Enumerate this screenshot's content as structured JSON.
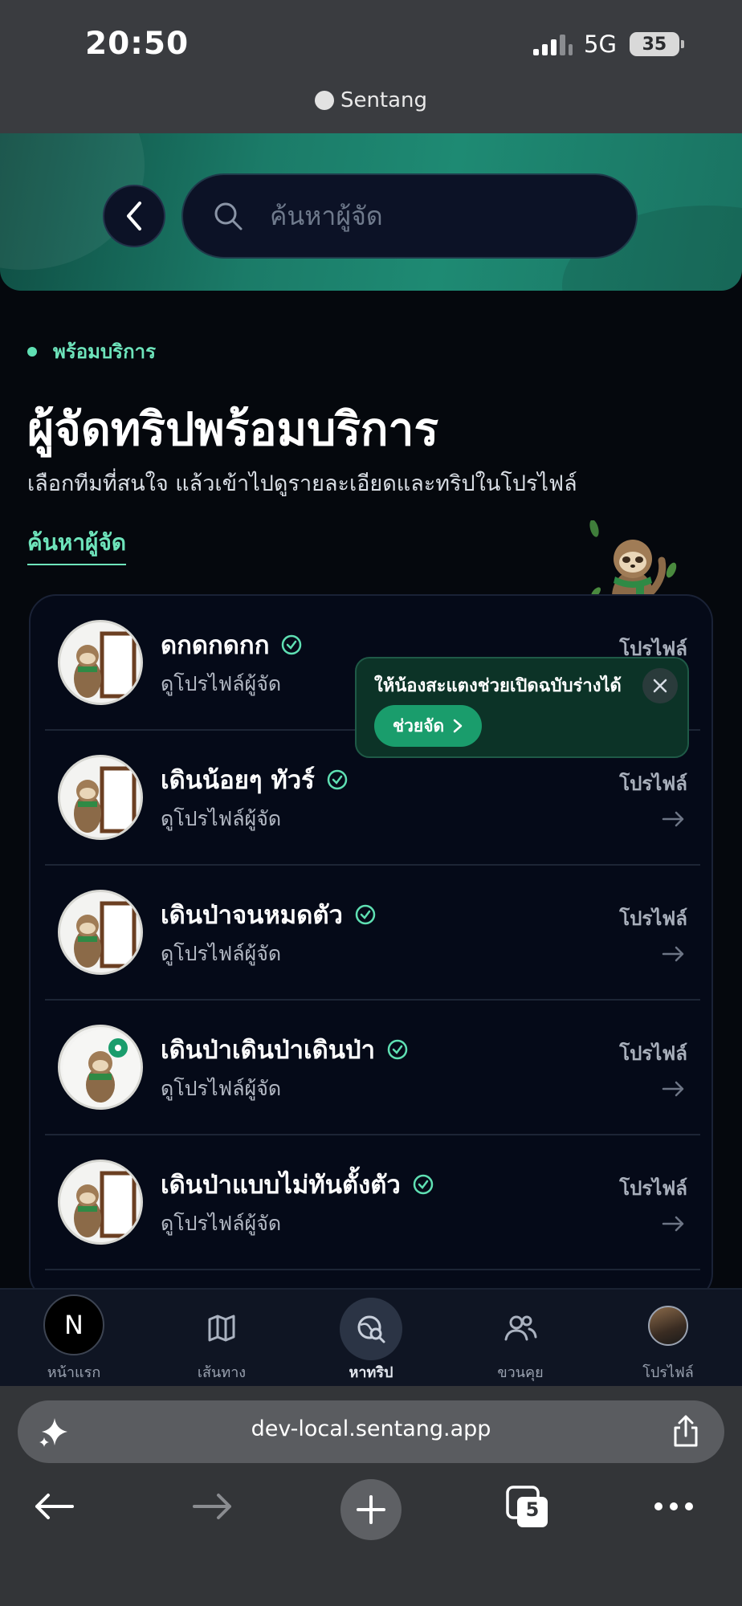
{
  "status_bar": {
    "time": "20:50",
    "network": "5G",
    "battery": "35",
    "site_chip": "Sentang"
  },
  "header": {
    "back_icon": "chevron-left-icon",
    "search_placeholder": "ค้นหาผู้จัด"
  },
  "section": {
    "pill": "พร้อมบริการ",
    "title": "ผู้จัดทริปพร้อมบริการ",
    "subtitle": "เลือกทีมที่สนใจ แล้วเข้าไปดูรายละเอียดและทริปในโปรไฟล์",
    "search_link": "ค้นหาผู้จัด"
  },
  "organizers": [
    {
      "name": "ดกดกดกก",
      "sub": "ดูโปรไฟล์ผู้จัด",
      "action": "โปรไฟล์",
      "avatar": "sloth-door"
    },
    {
      "name": "เดินน้อยๆ ทัวร์",
      "sub": "ดูโปรไฟล์ผู้จัด",
      "action": "โปรไฟล์",
      "avatar": "sloth-door"
    },
    {
      "name": "เดินป่าจนหมดตัว",
      "sub": "ดูโปรไฟล์ผู้จัด",
      "action": "โปรไฟล์",
      "avatar": "sloth-door"
    },
    {
      "name": "เดินป่าเดินป่าเดินป่า",
      "sub": "ดูโปรไฟล์ผู้จัด",
      "action": "โปรไฟล์",
      "avatar": "sloth-badge"
    },
    {
      "name": "เดินป่าแบบไม่ทันตั้งตัว",
      "sub": "ดูโปรไฟล์ผู้จัด",
      "action": "โปรไฟล์",
      "avatar": "sloth-door"
    }
  ],
  "tooltip": {
    "text": "ให้น้องสะแตงช่วยเปิดฉบับร่างได้",
    "button": "ช่วยจัด"
  },
  "bottom_nav": {
    "items": [
      {
        "label": "หน้าแรก",
        "icon": "n-logo-icon"
      },
      {
        "label": "เส้นทาง",
        "icon": "map-icon"
      },
      {
        "label": "หาทริป",
        "icon": "search-globe-icon",
        "active": true
      },
      {
        "label": "ขวนคุย",
        "icon": "users-icon"
      },
      {
        "label": "โปรไฟล์",
        "icon": "avatar-icon"
      }
    ],
    "home_glyph": "N"
  },
  "browser": {
    "url": "dev-local.sentang.app",
    "tabs_count": "5"
  },
  "colors": {
    "accent": "#6ee4bb",
    "background": "#05080d",
    "card": "#050a18",
    "tooltip": "#0c3327",
    "button": "#1a9d6c"
  }
}
